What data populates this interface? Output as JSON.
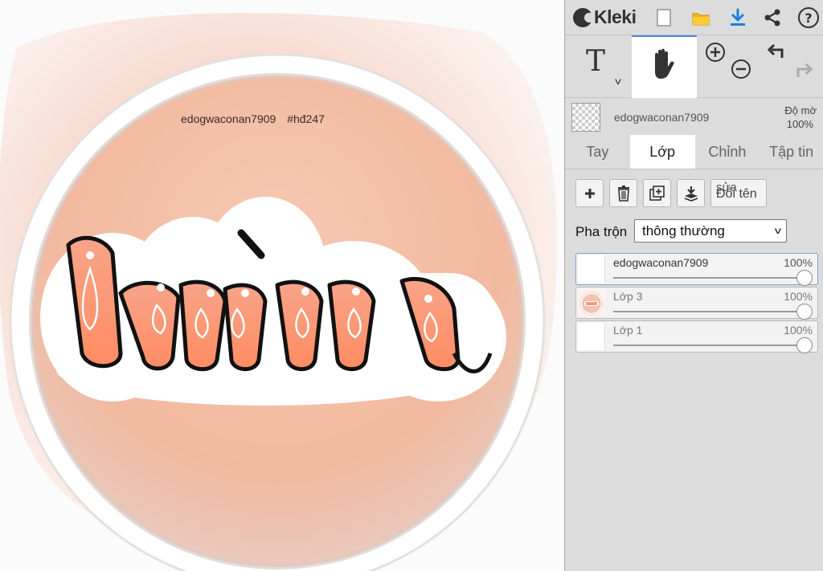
{
  "app": {
    "name": "Kleki"
  },
  "canvas": {
    "watermark_user": "edogwaconan7909",
    "watermark_tag": "#hđ247",
    "artwork_text": "làm"
  },
  "topbar": {
    "icons": [
      "kleki-logo-icon",
      "new-file-icon",
      "open-folder-icon",
      "download-icon",
      "share-icon",
      "help-icon"
    ],
    "accent": "#1a7fe0"
  },
  "tools": [
    "text-tool-icon",
    "hand-tool-icon",
    "zoom-in-icon",
    "zoom-out-icon",
    "undo-icon",
    "redo-icon"
  ],
  "layer_info": {
    "name": "edogwaconan7909",
    "opacity_label": "Độ mờ",
    "opacity_value": "100%"
  },
  "tabs": [
    {
      "label": "Tay",
      "active": false
    },
    {
      "label": "Lớp",
      "active": true
    },
    {
      "label": "Chỉnh",
      "active": false
    },
    {
      "label": "Tập tin",
      "active": false
    }
  ],
  "layer_buttons": {
    "rename_a": "sửa",
    "rename_b": "Đổi tên"
  },
  "blend": {
    "label": "Pha trộn",
    "value": "thông thường"
  },
  "layers": [
    {
      "name": "edogwaconan7909",
      "opacity": "100%",
      "opacity_value": 1.0,
      "selected": true
    },
    {
      "name": "Lớp 3",
      "opacity": "100%",
      "opacity_value": 1.0,
      "selected": false
    },
    {
      "name": "Lớp 1",
      "opacity": "100%",
      "opacity_value": 1.0,
      "selected": false
    }
  ]
}
